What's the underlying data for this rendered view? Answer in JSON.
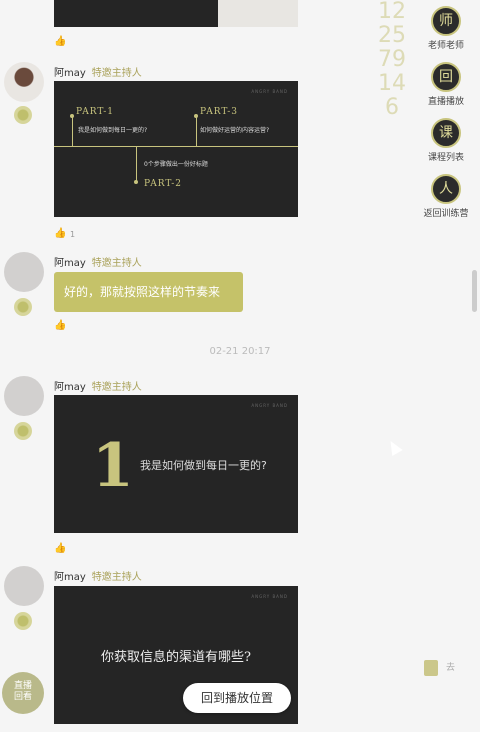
{
  "host": {
    "name": "阿may",
    "role": "特邀主持人"
  },
  "timeline_slide": {
    "brand": "ANGRY BAND",
    "part1_label": "PART-1",
    "part1_text": "我是如何做到每日一更的?",
    "part3_label": "PART-3",
    "part3_text": "如何做好运营的内容运营?",
    "part2_text": "0个步骤做出一份好标题",
    "part2_label": "PART-2"
  },
  "like_count": "1",
  "text_bubble": "好的，那就按照这样的节奏来",
  "timestamp": "02-21 20:17",
  "number_slide": {
    "brand": "ANGRY BAND",
    "number": "1",
    "text": "我是如何做到每日一更的?"
  },
  "question_slide": {
    "brand": "ANGRY BAND",
    "text": "你获取信息的渠道有哪些?"
  },
  "return_button": "回到播放位置",
  "watermark": "122579146",
  "side_menu": [
    {
      "label": "老师老师",
      "icon": "teacher-icon",
      "glyph": "师"
    },
    {
      "label": "直播播放",
      "icon": "play-icon",
      "glyph": "回"
    },
    {
      "label": "课程列表",
      "icon": "list-icon",
      "glyph": "课"
    },
    {
      "label": "返回训练营",
      "icon": "camp-icon",
      "glyph": "人"
    }
  ],
  "live_badge": {
    "line1": "直播",
    "line2": "回看"
  },
  "cart_label": "去"
}
